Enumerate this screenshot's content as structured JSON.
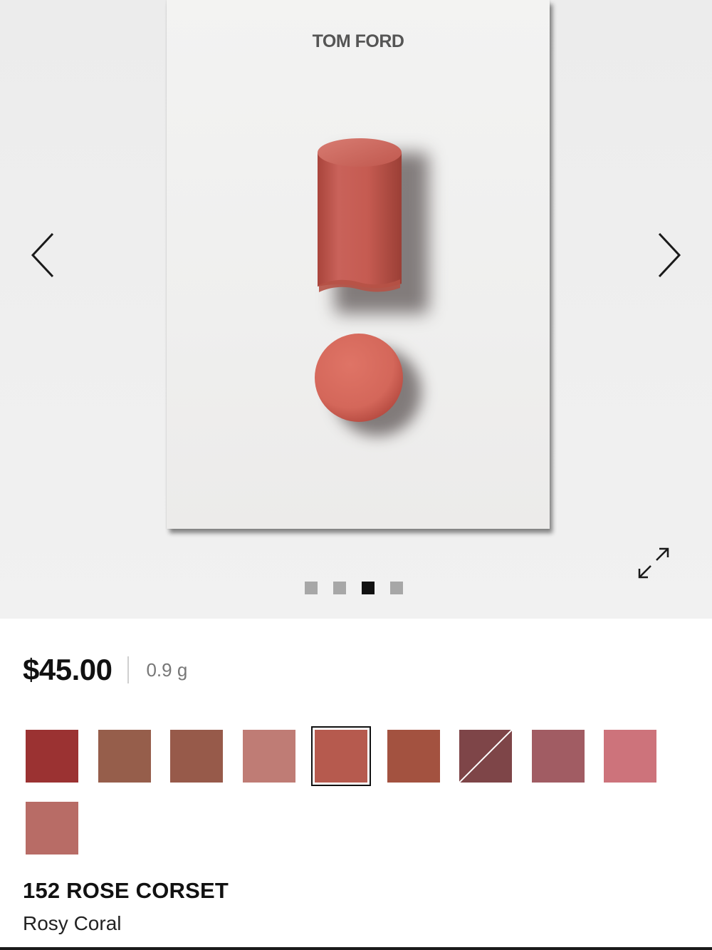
{
  "gallery": {
    "brand": "TOM FORD",
    "prev_icon": "chevron-left-icon",
    "next_icon": "chevron-right-icon",
    "expand_icon": "expand-icon",
    "product_color": "#c4574c",
    "slide_count": 4,
    "active_slide": 3
  },
  "product": {
    "price": "$45.00",
    "size": "0.9 g",
    "shade_name": "152 ROSE CORSET",
    "shade_description": "Rosy Coral"
  },
  "swatches": [
    {
      "color": "#9b3232",
      "selected": false,
      "unavailable": false
    },
    {
      "color": "#965e4b",
      "selected": false,
      "unavailable": false
    },
    {
      "color": "#975a4a",
      "selected": false,
      "unavailable": false
    },
    {
      "color": "#bf7c75",
      "selected": false,
      "unavailable": false
    },
    {
      "color": "#b65a4e",
      "selected": true,
      "unavailable": false
    },
    {
      "color": "#a35240",
      "selected": false,
      "unavailable": false
    },
    {
      "color": "#7e4548",
      "selected": false,
      "unavailable": true
    },
    {
      "color": "#a15c63",
      "selected": false,
      "unavailable": false
    },
    {
      "color": "#cd737b",
      "selected": false,
      "unavailable": false
    },
    {
      "color": "#b86c66",
      "selected": false,
      "unavailable": false
    }
  ]
}
